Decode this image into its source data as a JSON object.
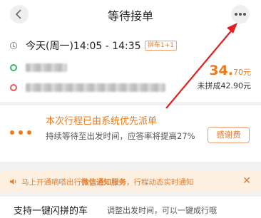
{
  "header": {
    "title": "等待接单",
    "back_icon": "chevron-left-icon",
    "more_icon": "more-horizontal-icon"
  },
  "trip": {
    "time": "今天(周一)14:05 - 14:35",
    "carpool_tag": "拼车1+1",
    "price_value": "34.",
    "price_unit": "70元",
    "no_carpool_price": "未拼成42.90元"
  },
  "dispatch": {
    "title": "本次行程已由系统优先派单",
    "description": "持续等待至出发时间，应答率将提高27%",
    "thanks_label": "感谢费"
  },
  "notice": {
    "text_prefix": "马上开通嘀嗒出行",
    "text_highlight": "微信通知服务",
    "text_suffix": "，行程动态实时通知",
    "close_icon": "close-icon"
  },
  "bottom": {
    "title": "支持一键闪拼的车",
    "description": "调整出发时间，可以一键成行哦"
  },
  "colors": {
    "accent": "#f07a1a",
    "notice_bg": "#fdf0e1",
    "annotation": "#e0211f"
  }
}
